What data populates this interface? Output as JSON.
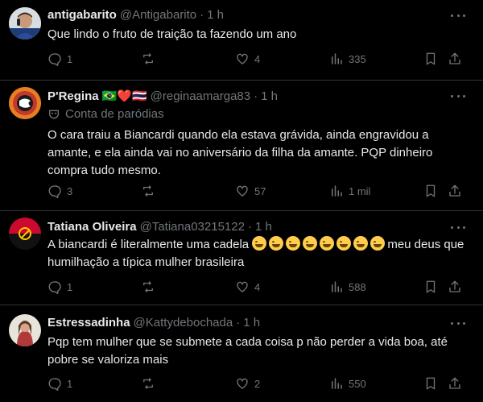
{
  "tweets": [
    {
      "name": "antigabarito",
      "handle": "@Antigabarito",
      "dot": "·",
      "time": "1 h",
      "text": "Que lindo o fruto de traição ta fazendo um ano",
      "replies": "1",
      "reposts": "",
      "likes": "4",
      "views": "335"
    },
    {
      "name": "P'Regina",
      "flags": "🇧🇷❤️🇹🇭",
      "handle": "@reginaamarga83",
      "dot": "·",
      "time": "1 h",
      "badge": "Conta de paródias",
      "text": "O cara traiu a Biancardi quando ela estava grávida, ainda engravidou a amante, e ela ainda vai no aniversário da filha da amante. PQP dinheiro compra tudo mesmo.",
      "replies": "3",
      "reposts": "",
      "likes": "57",
      "views": "1 mil"
    },
    {
      "name": "Tatiana Oliveira",
      "handle": "@Tatiana03215122",
      "dot": "·",
      "time": "1 h",
      "text_before": "A biancardi é literalmente uma cadela",
      "emoji_count": 8,
      "text_after": "meu deus que humilhação a típica mulher brasileira",
      "replies": "1",
      "reposts": "",
      "likes": "4",
      "views": "588"
    },
    {
      "name": "Estressadinha",
      "handle": "@Kattydebochada",
      "dot": "·",
      "time": "1 h",
      "text": "Pqp tem mulher que se submete a cada coisa p não perder a vida boa, até pobre se valoriza mais",
      "replies": "1",
      "reposts": "",
      "likes": "2",
      "views": "550"
    }
  ],
  "icons": {
    "reply": "reply-icon",
    "repost": "repost-icon",
    "like": "like-icon",
    "views": "views-icon",
    "bookmark": "bookmark-icon",
    "share": "share-icon",
    "more": "more-icon"
  },
  "colors": {
    "background": "#000000",
    "text": "#e7e9ea",
    "muted": "#71767b",
    "divider": "#2f3336"
  }
}
